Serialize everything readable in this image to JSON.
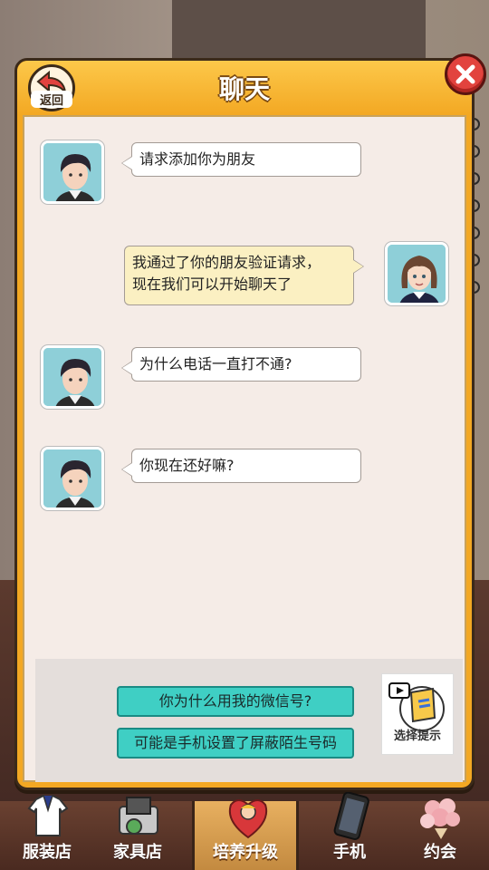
{
  "dialog": {
    "title": "聊天",
    "back_label": "返回"
  },
  "messages": [
    {
      "side": "left",
      "sender": "boy",
      "text": "请求添加你为朋友"
    },
    {
      "side": "right",
      "sender": "girl",
      "line1": "我通过了你的朋友验证请求，",
      "line2": "现在我们可以开始聊天了"
    },
    {
      "side": "left",
      "sender": "boy",
      "text": "为什么电话一直打不通?"
    },
    {
      "side": "left",
      "sender": "boy",
      "text": "你现在还好嘛?"
    }
  ],
  "options": [
    {
      "label": "你为什么用我的微信号?"
    },
    {
      "label": "可能是手机设置了屏蔽陌生号码"
    }
  ],
  "hint": {
    "label": "选择提示",
    "icon": "video-hint-icon"
  },
  "bottom_nav": {
    "items": [
      {
        "label": "服装店",
        "icon": "clothing-icon"
      },
      {
        "label": "家具店",
        "icon": "furniture-icon"
      },
      {
        "label": "培养升级",
        "icon": "cupid-icon",
        "active": true
      },
      {
        "label": "手机",
        "icon": "phone-icon"
      },
      {
        "label": "约会",
        "icon": "flowers-icon"
      }
    ]
  },
  "colors": {
    "dialog_frame": "#f3a823",
    "option_button": "#3fcfc4",
    "close_button": "#e2433e"
  }
}
